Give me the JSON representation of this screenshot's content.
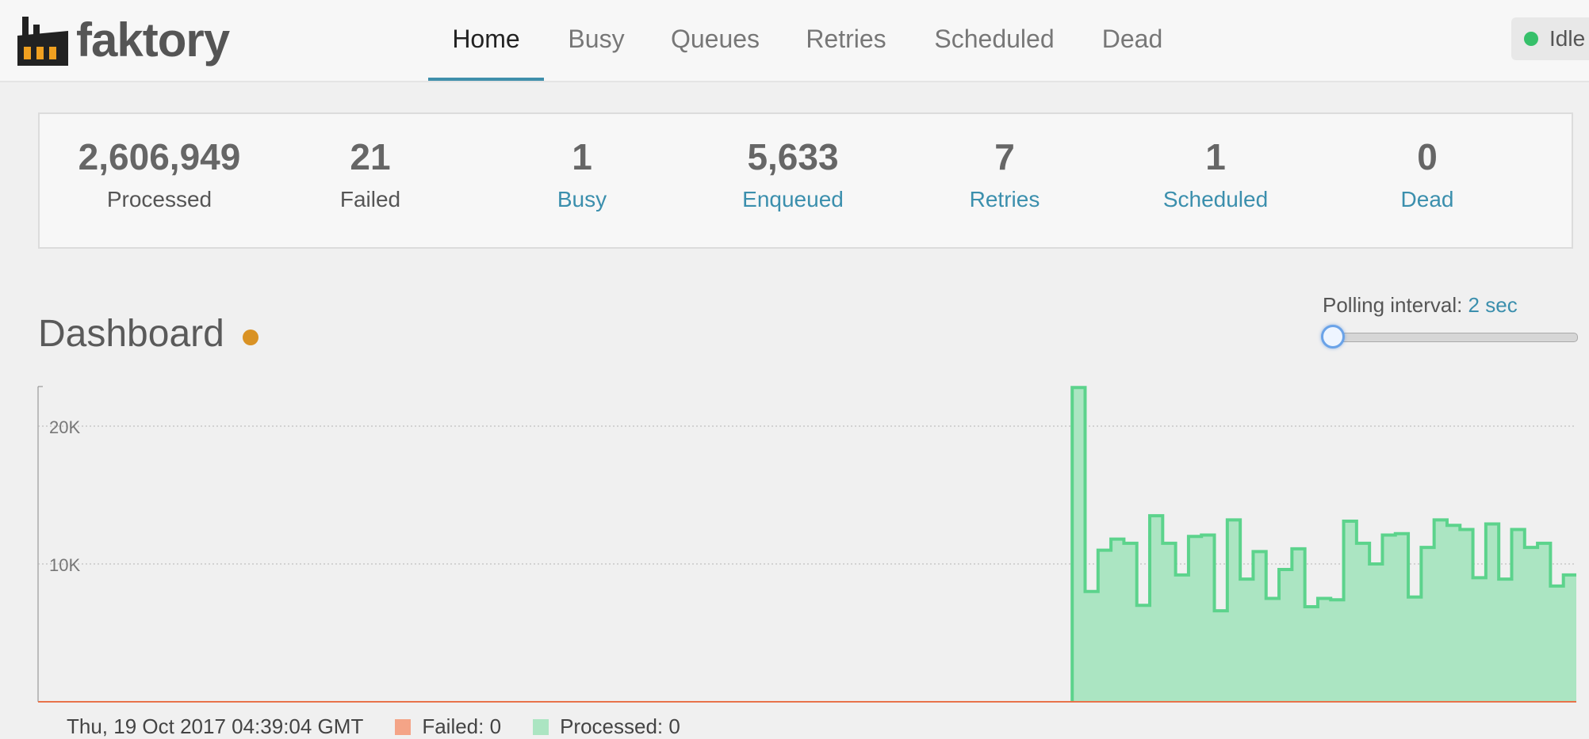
{
  "brand": {
    "name": "faktory"
  },
  "nav": {
    "items": [
      {
        "label": "Home",
        "active": true
      },
      {
        "label": "Busy",
        "active": false
      },
      {
        "label": "Queues",
        "active": false
      },
      {
        "label": "Retries",
        "active": false
      },
      {
        "label": "Scheduled",
        "active": false
      },
      {
        "label": "Dead",
        "active": false
      }
    ],
    "status": {
      "label": "Idle",
      "color": "#36c06a"
    }
  },
  "stats": [
    {
      "value": "2,606,949",
      "label": "Processed"
    },
    {
      "value": "21",
      "label": "Failed"
    },
    {
      "value": "1",
      "label": "Busy"
    },
    {
      "value": "5,633",
      "label": "Enqueued"
    },
    {
      "value": "7",
      "label": "Retries"
    },
    {
      "value": "1",
      "label": "Scheduled"
    },
    {
      "value": "0",
      "label": "Dead"
    }
  ],
  "dashboard": {
    "title": "Dashboard",
    "polling": {
      "label": "Polling interval:",
      "value": "2 sec",
      "slider_level": 0
    }
  },
  "chart_data": {
    "type": "area",
    "yticks": [
      "10K",
      "20K"
    ],
    "ylim": [
      0,
      23000
    ],
    "grid": true,
    "colors": {
      "processed": "#5cd38c",
      "processed_fill": "#abe5c2",
      "failed": "#e8734a"
    },
    "series": [
      {
        "name": "Processed",
        "values": [
          0,
          0,
          0,
          0,
          0,
          0,
          0,
          0,
          0,
          0,
          0,
          0,
          0,
          0,
          0,
          0,
          0,
          0,
          0,
          0,
          0,
          0,
          0,
          0,
          0,
          0,
          0,
          0,
          0,
          0,
          0,
          0,
          0,
          0,
          0,
          0,
          0,
          0,
          0,
          0,
          0,
          0,
          0,
          0,
          0,
          0,
          0,
          0,
          0,
          0,
          0,
          0,
          0,
          0,
          0,
          0,
          0,
          0,
          0,
          0,
          0,
          0,
          0,
          0,
          0,
          0,
          0,
          0,
          0,
          0,
          0,
          0,
          0,
          0,
          0,
          0,
          0,
          0,
          0,
          0,
          22800,
          8000,
          11000,
          11800,
          11500,
          7000,
          13500,
          11500,
          9200,
          12000,
          12100,
          6600,
          13200,
          8900,
          10900,
          7500,
          9600,
          11100,
          6900,
          7500,
          7400,
          13100,
          11500,
          10000,
          12100,
          12200,
          7600,
          11200,
          13200,
          12800,
          12500,
          9000,
          12900,
          8900,
          12500,
          11200,
          11500,
          8400,
          9200
        ]
      },
      {
        "name": "Failed",
        "values": []
      }
    ],
    "legend": [
      {
        "label": "Thu, 19 Oct 2017 04:39:04 GMT"
      },
      {
        "label": "Failed: 0"
      },
      {
        "label": "Processed: 0"
      }
    ]
  }
}
